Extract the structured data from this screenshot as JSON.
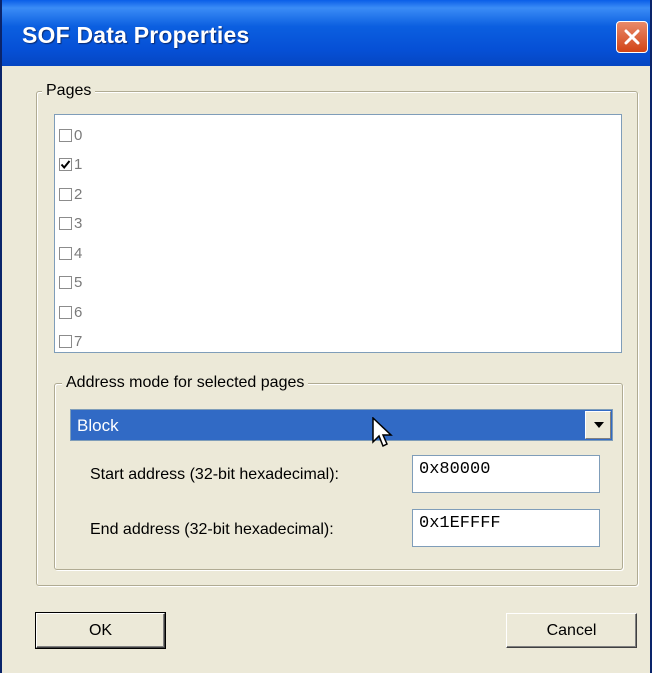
{
  "window": {
    "title": "SOF Data Properties"
  },
  "pages_group": {
    "legend": "Pages",
    "items": [
      {
        "label": "0",
        "checked": false
      },
      {
        "label": "1",
        "checked": true
      },
      {
        "label": "2",
        "checked": false
      },
      {
        "label": "3",
        "checked": false
      },
      {
        "label": "4",
        "checked": false
      },
      {
        "label": "5",
        "checked": false
      },
      {
        "label": "6",
        "checked": false
      },
      {
        "label": "7",
        "checked": false
      }
    ]
  },
  "address_group": {
    "legend": "Address mode for selected pages",
    "mode_selected": "Block",
    "start_label": "Start address (32-bit hexadecimal):",
    "start_value": "0x80000",
    "end_label": "End address (32-bit hexadecimal):",
    "end_value": "0x1EFFFF"
  },
  "buttons": {
    "ok": "OK",
    "cancel": "Cancel"
  },
  "colors": {
    "titlebar": "#0a5ee8",
    "selection": "#316ac5",
    "dialog_bg": "#ece9d8",
    "close": "#d24416"
  },
  "icons": {
    "close": "close-icon",
    "checkmark": "checkmark-icon",
    "dropdown": "chevron-down-icon",
    "cursor": "mouse-pointer-icon"
  }
}
